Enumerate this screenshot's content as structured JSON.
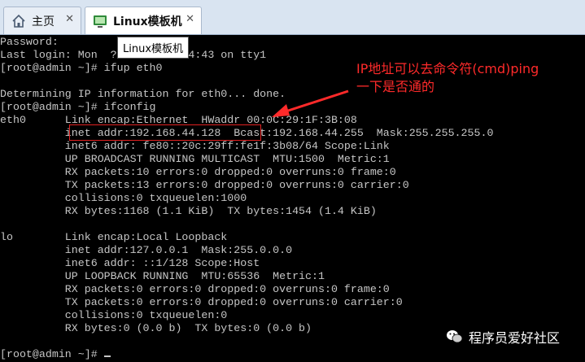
{
  "tabs": [
    {
      "label": "主页",
      "icon": "home-icon"
    },
    {
      "label": "Linux模板机",
      "icon": "vm-icon",
      "active": true
    }
  ],
  "tooltip": "Linux模板机",
  "terminal": {
    "lines": [
      "Password:",
      "Last login: Mon  ?? 2018 ??:54:43 on tty1",
      "[root@admin ~]# ifup eth0",
      "",
      "Determining IP information for eth0... done.",
      "[root@admin ~]# ifconfig",
      "eth0      Link encap:Ethernet  HWaddr 00:0C:29:1F:3B:08",
      "          inet addr:192.168.44.128  Bcast:192.168.44.255  Mask:255.255.255.0",
      "          inet6 addr: fe80::20c:29ff:fe1f:3b08/64 Scope:Link",
      "          UP BROADCAST RUNNING MULTICAST  MTU:1500  Metric:1",
      "          RX packets:10 errors:0 dropped:0 overruns:0 frame:0",
      "          TX packets:13 errors:0 dropped:0 overruns:0 carrier:0",
      "          collisions:0 txqueuelen:1000",
      "          RX bytes:1168 (1.1 KiB)  TX bytes:1454 (1.4 KiB)",
      "",
      "lo        Link encap:Local Loopback",
      "          inet addr:127.0.0.1  Mask:255.0.0.0",
      "          inet6 addr: ::1/128 Scope:Host",
      "          UP LOOPBACK RUNNING  MTU:65536  Metric:1",
      "          RX packets:0 errors:0 dropped:0 overruns:0 frame:0",
      "          TX packets:0 errors:0 dropped:0 overruns:0 carrier:0",
      "          collisions:0 txqueuelen:0",
      "          RX bytes:0 (0.0 b)  TX bytes:0 (0.0 b)",
      "",
      "",
      "[root@admin ~]# "
    ]
  },
  "annotation": {
    "line1": "IP地址可以去命令符(cmd)ping",
    "line2": "一下是否通的",
    "color": "#ff2a2a"
  },
  "watermark": "程序员爱好社区"
}
